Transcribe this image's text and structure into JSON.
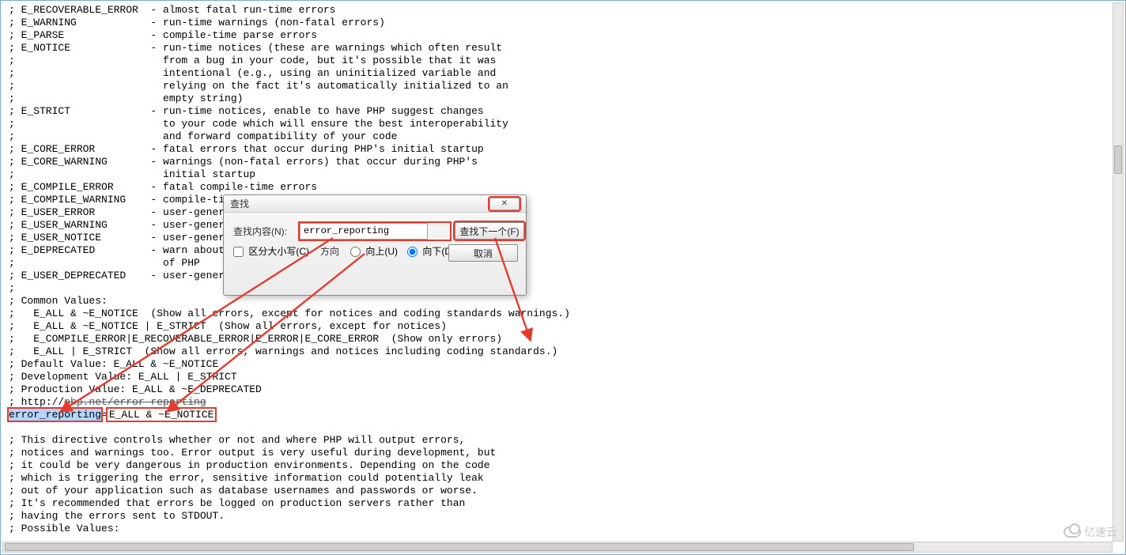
{
  "editor": {
    "lines": [
      "; E_RECOVERABLE_ERROR  - almost fatal run-time errors",
      "; E_WARNING            - run-time warnings (non-fatal errors)",
      "; E_PARSE              - compile-time parse errors",
      "; E_NOTICE             - run-time notices (these are warnings which often result",
      ";                        from a bug in your code, but it's possible that it was",
      ";                        intentional (e.g., using an uninitialized variable and",
      ";                        relying on the fact it's automatically initialized to an",
      ";                        empty string)",
      "; E_STRICT             - run-time notices, enable to have PHP suggest changes",
      ";                        to your code which will ensure the best interoperability",
      ";                        and forward compatibility of your code",
      "; E_CORE_ERROR         - fatal errors that occur during PHP's initial startup",
      "; E_CORE_WARNING       - warnings (non-fatal errors) that occur during PHP's",
      ";                        initial startup",
      "; E_COMPILE_ERROR      - fatal compile-time errors",
      "; E_COMPILE_WARNING    - compile-time",
      "; E_USER_ERROR         - user-generat",
      "; E_USER_WARNING       - user-generat",
      "; E_USER_NOTICE        - user-generat",
      "; E_DEPRECATED         - warn about c",
      ";                        of PHP",
      "; E_USER_DEPRECATED    - user-generat",
      ";",
      "; Common Values:",
      ";   E_ALL & ~E_NOTICE  (Show all errors, except for notices and coding standards warnings.)",
      ";   E_ALL & ~E_NOTICE | E_STRICT  (Show all errors, except for notices)",
      ";   E_COMPILE_ERROR|E_RECOVERABLE_ERROR|E_ERROR|E_CORE_ERROR  (Show only errors)",
      ";   E_ALL | E_STRICT  (Show all errors, warnings and notices including coding standards.)",
      "; Default Value: E_ALL & ~E_NOTICE",
      "; Development Value: E_ALL | E_STRICT",
      "; Production Value: E_ALL & ~E_DEPRECATED",
      "",
      "",
      "",
      "; This directive controls whether or not and where PHP will output errors,",
      "; notices and warnings too. Error output is very useful during development, but",
      "; it could be very dangerous in production environments. Depending on the code",
      "; which is triggering the error, sensitive information could potentially leak",
      "; out of your application such as database usernames and passwords or worse.",
      "; It's recommended that errors be logged on production servers rather than",
      "; having the errors sent to STDOUT.",
      "; Possible Values:"
    ],
    "link_prefix": "; ",
    "link_protocol": "http://",
    "link_body": "php.net/error-reporting",
    "setting": {
      "selected": "error_reporting",
      "eq": "=",
      "value": "E_ALL & ~E_NOTICE"
    }
  },
  "dialog": {
    "title": "查找",
    "close_glyph": "✕",
    "label_what": "查找内容(N):",
    "input_value": "error_reporting",
    "btn_next": "查找下一个(F)",
    "btn_cancel": "取消",
    "case_label": "区分大小写(C)",
    "direction_label": "方向",
    "radio_up": "向上(U)",
    "radio_down": "向下(D)"
  },
  "watermark": "亿速云"
}
